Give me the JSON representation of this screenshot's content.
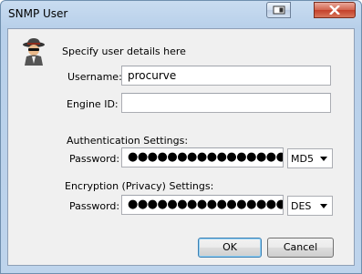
{
  "window": {
    "title": "SNMP User"
  },
  "header": {
    "instruction": "Specify user details here",
    "icon": "spy-agent-icon"
  },
  "fields": {
    "username_label": "Username:",
    "username_value": "procurve",
    "engine_id_label": "Engine ID:",
    "engine_id_value": ""
  },
  "authentication": {
    "section_label": "Authentication Settings:",
    "password_label": "Password:",
    "password_value": "●●●●●●●●●●●●●●●●●●●●●●●●●●●●",
    "protocol": "MD5"
  },
  "encryption": {
    "section_label": "Encryption (Privacy) Settings:",
    "password_label": "Password:",
    "password_value": "●●●●●●●●●●●●●●●●●●●●●●●●●●●●",
    "protocol": "DES"
  },
  "buttons": {
    "ok": "OK",
    "cancel": "Cancel"
  }
}
